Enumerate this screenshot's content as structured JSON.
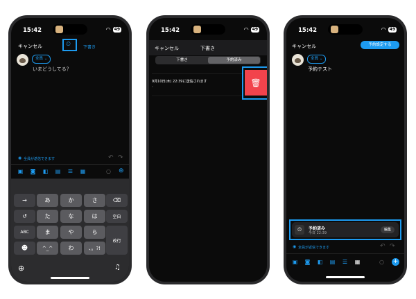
{
  "status_bar": {
    "time": "15:42",
    "battery": "49"
  },
  "phone1": {
    "cancel": "キャンセル",
    "drafts": "下書き",
    "audience": "全員 ⌄",
    "placeholder": "いまどうしてる？",
    "reply_setting": "全員が返信できます",
    "keys": {
      "r1": [
        "→",
        "あ",
        "か",
        "さ",
        "⌫"
      ],
      "r2": [
        "↺",
        "た",
        "な",
        "は",
        "空白"
      ],
      "r3": [
        "ABC",
        "ま",
        "や",
        "ら",
        "改行"
      ],
      "r4": [
        "☻",
        "^_^",
        "わ",
        "、。?!"
      ]
    }
  },
  "phone2": {
    "cancel": "キャンセル",
    "title": "下書き",
    "seg_drafts": "下書き",
    "seg_scheduled": "予約済み",
    "item_text": "9月10日(木) 22:39に送信されます",
    "item_sub": "-"
  },
  "phone3": {
    "cancel": "キャンセル",
    "schedule_btn": "予約設定する",
    "audience": "全員 ⌄",
    "text": "予約テスト",
    "card_title": "予約済み",
    "card_time": "今日 22:39",
    "edit": "編集",
    "reply_setting": "全員が返信できます"
  },
  "colors": {
    "accent": "#1d9bf0",
    "delete": "#f2434c"
  }
}
